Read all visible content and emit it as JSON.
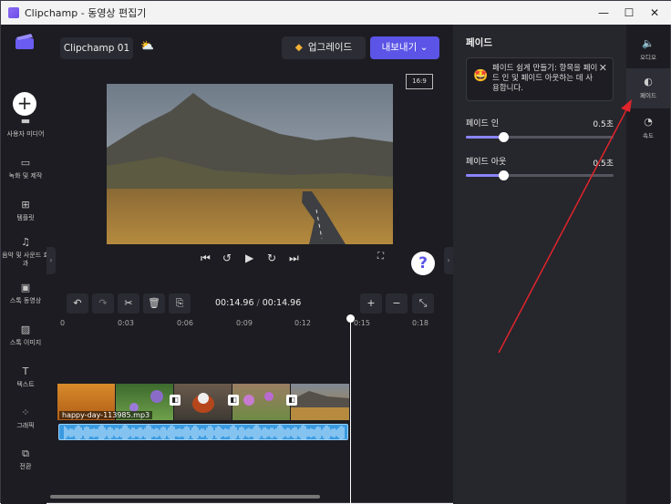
{
  "titlebar": {
    "title": "Clipchamp - 동영상 편집기",
    "minimize": "—",
    "maximize": "☐",
    "close": "✕"
  },
  "rail": {
    "items": [
      {
        "label": "사용자 미디어",
        "icon": "folder-icon"
      },
      {
        "label": "녹화 및 제작",
        "icon": "record-icon"
      },
      {
        "label": "템플릿",
        "icon": "template-icon"
      },
      {
        "label": "음악 및 사운드 효과",
        "icon": "music-icon"
      },
      {
        "label": "스톡 동영상",
        "icon": "film-icon"
      },
      {
        "label": "스톡 이미지",
        "icon": "image-icon"
      },
      {
        "label": "텍스트",
        "icon": "text-icon"
      },
      {
        "label": "그래픽",
        "icon": "graphics-icon"
      },
      {
        "label": "전환",
        "icon": "transition-icon"
      }
    ]
  },
  "topbar": {
    "project_name": "Clipchamp 01",
    "upgrade": "업그레이드",
    "export": "내보내기"
  },
  "preview": {
    "aspect": "16:9"
  },
  "timeline": {
    "current": "00:14.96",
    "separator": " / ",
    "total": "00:14.96",
    "ticks": [
      "0",
      "0:03",
      "0:06",
      "0:09",
      "0:12",
      "0:15",
      "0:18"
    ],
    "audio_clip": "happy-day-113985.mp3"
  },
  "panel": {
    "title": "페이드",
    "tip": "페이드 쉽게 만들기: 항목을 페이드 인 및 페이드 아웃하는 데 사용합니다.",
    "fade_in": {
      "label": "페이드 인",
      "value": "0.5초",
      "fraction": 0.25
    },
    "fade_out": {
      "label": "페이드 아웃",
      "value": "0.5초",
      "fraction": 0.25
    }
  },
  "properties": {
    "items": [
      {
        "label": "오디오",
        "icon": "speaker-icon"
      },
      {
        "label": "페이드",
        "icon": "fade-icon"
      },
      {
        "label": "속도",
        "icon": "speedometer-icon"
      }
    ]
  },
  "colors": {
    "accent": "#5b54e6",
    "annotation_arrow": "#e0242b"
  }
}
